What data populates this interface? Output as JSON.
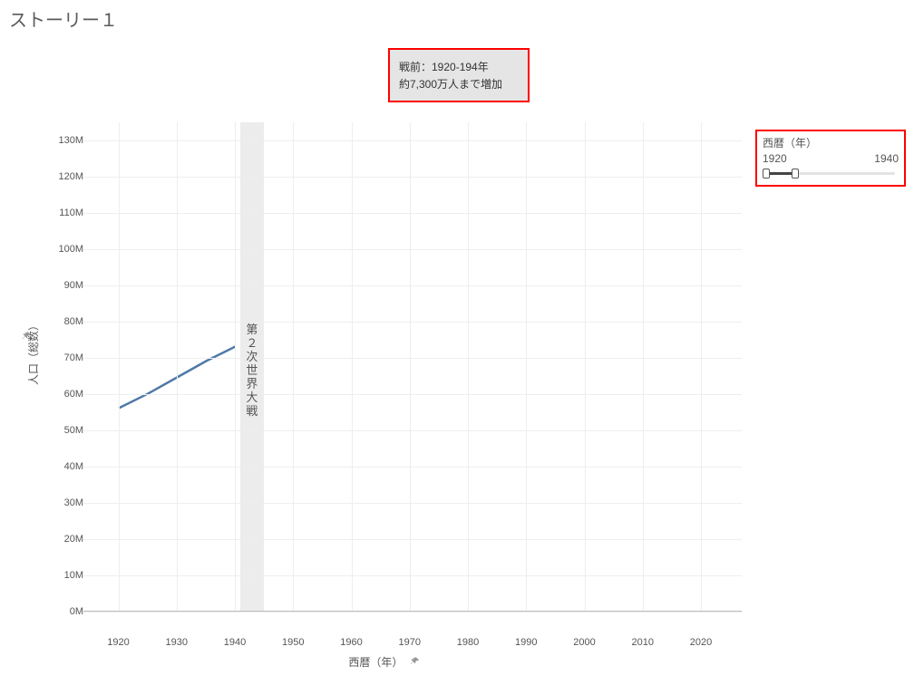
{
  "page_title": "ストーリー１",
  "caption": {
    "line1": "戦前：1920-194年",
    "line2": "約7,300万人まで増加"
  },
  "filter": {
    "title": "西暦（年）",
    "from": "1920",
    "to": "1940"
  },
  "axis": {
    "x_title": "西暦（年）",
    "y_title": "人口（総数）"
  },
  "chart_data": {
    "type": "line",
    "title": "",
    "xlabel": "西暦（年）",
    "ylabel": "人口（総数）",
    "x_ticks": [
      1920,
      1930,
      1940,
      1950,
      1960,
      1970,
      1980,
      1990,
      2000,
      2010,
      2020
    ],
    "y_ticks_millions": [
      0,
      10,
      20,
      30,
      40,
      50,
      60,
      70,
      80,
      90,
      100,
      110,
      120,
      130
    ],
    "y_tick_labels": [
      "0M",
      "10M",
      "20M",
      "30M",
      "40M",
      "50M",
      "60M",
      "70M",
      "80M",
      "90M",
      "100M",
      "110M",
      "120M",
      "130M"
    ],
    "xlim": [
      1914,
      2027
    ],
    "ylim": [
      0,
      135
    ],
    "reference_band": {
      "start": 1941,
      "end": 1945,
      "label": "第２次世界大戦"
    },
    "series": [
      {
        "name": "人口（総数）",
        "x": [
          1920,
          1925,
          1930,
          1935,
          1940
        ],
        "values": [
          56000000,
          60000000,
          64500000,
          69000000,
          73000000
        ]
      }
    ]
  }
}
